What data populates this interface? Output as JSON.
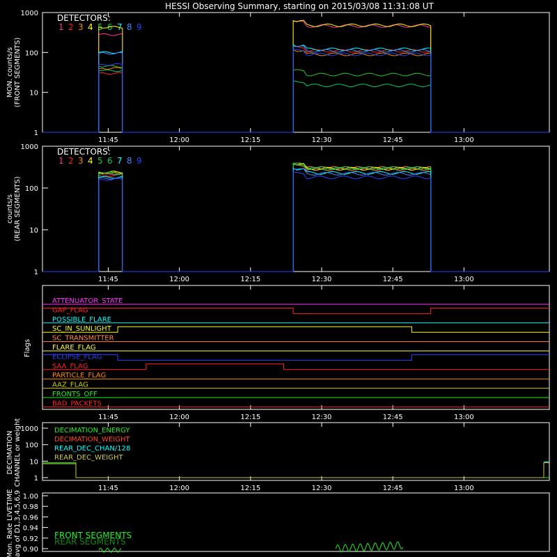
{
  "title": "HESSI Observing Summary, starting on 2015/03/08 11:31:08 UT",
  "time_ticks": [
    "11:45",
    "12:00",
    "12:15",
    "12:30",
    "12:45",
    "13:00"
  ],
  "det_colors": [
    "#ff3399",
    "#ff2222",
    "#ff8800",
    "#ffff00",
    "#22cc22",
    "#00cc66",
    "#00ffff",
    "#4488ff",
    "#2244ff"
  ],
  "chart_data": [
    {
      "type": "line",
      "ylabel": [
        "MON. counts/s",
        "(FRONT SEGMENTS)"
      ],
      "yscale": "log",
      "ylim": [
        1,
        1000
      ],
      "yticks": [
        "1",
        "10",
        "100",
        "1000"
      ],
      "legend_title": "DETECTORS:",
      "legend_numbers": [
        "1",
        "2",
        "3",
        "4",
        "5",
        "6",
        "7",
        "8",
        "9"
      ],
      "intervals": [
        {
          "start": "11:43",
          "end": "11:48"
        },
        {
          "start": "12:24",
          "end": "12:53"
        }
      ],
      "series": [
        {
          "values_first": 280,
          "values_second": 460
        },
        {
          "values_first": 30,
          "values_second": 110
        },
        {
          "values_first": 40,
          "values_second": 90
        },
        {
          "values_first": 430,
          "values_second": 480
        },
        {
          "values_first": 45,
          "values_second": 28
        },
        {
          "values_first": 35,
          "values_second": 15
        },
        {
          "values_first": 100,
          "values_second": 120
        },
        {
          "values_first": 95,
          "values_second": 110
        },
        {
          "values_first": 50,
          "values_second": 90
        }
      ]
    },
    {
      "type": "line",
      "ylabel": [
        "counts/s",
        "(REAR SEGMENTS)"
      ],
      "yscale": "log",
      "ylim": [
        1,
        1000
      ],
      "yticks": [
        "1",
        "10",
        "100",
        "1000"
      ],
      "legend_title": "DETECTORS:",
      "legend_numbers": [
        "1",
        "2",
        "3",
        "4",
        "5",
        "6",
        "7",
        "8",
        "9"
      ],
      "intervals": [
        {
          "start": "11:43",
          "end": "11:48"
        },
        {
          "start": "12:24",
          "end": "12:53"
        }
      ],
      "series": [
        {
          "values_first": 220,
          "values_second": 300
        },
        {
          "values_first": 200,
          "values_second": 280
        },
        {
          "values_first": 230,
          "values_second": 300
        },
        {
          "values_first": 240,
          "values_second": 290
        },
        {
          "values_first": 230,
          "values_second": 300
        },
        {
          "values_first": 220,
          "values_second": 290
        },
        {
          "values_first": 180,
          "values_second": 230
        },
        {
          "values_first": 170,
          "values_second": 220
        },
        {
          "values_first": 160,
          "values_second": 180
        }
      ]
    },
    {
      "type": "step",
      "ylabel": "Flags",
      "flags": [
        {
          "name": "ATTENUATOR_STATE",
          "color": "#ff33ff",
          "transitions": []
        },
        {
          "name": "GAP_FLAG",
          "color": "#ff2222",
          "transitions": [
            "12:24",
            "12:53"
          ]
        },
        {
          "name": "POSSIBLE_FLARE",
          "color": "#00ffff",
          "transitions": []
        },
        {
          "name": "SC_IN_SUNLIGHT",
          "color": "#ffff00",
          "transitions": [
            "11:47",
            "12:49"
          ]
        },
        {
          "name": "SC_TRANSMITTER",
          "color": "#ff8844",
          "transitions": []
        },
        {
          "name": "FLARE_FLAG",
          "color": "#ffff44",
          "transitions": []
        },
        {
          "name": "ECLIPSE_FLAG",
          "color": "#2244ff",
          "transitions": [
            "11:47",
            "12:49"
          ]
        },
        {
          "name": "SAA_FLAG",
          "color": "#ff2222",
          "transitions": [
            "11:53",
            "12:22"
          ]
        },
        {
          "name": "PARTICLE_FLAG",
          "color": "#ff8800",
          "transitions": []
        },
        {
          "name": "AAZ_FLAG",
          "color": "#cccc00",
          "transitions": []
        },
        {
          "name": "FRONTS_OFF",
          "color": "#22ee22",
          "transitions": []
        },
        {
          "name": "BAD_PACKETS",
          "color": "#ff2222",
          "transitions": []
        }
      ]
    },
    {
      "type": "line",
      "ylabel": [
        "DECIMATION",
        "CHANNEL or weight"
      ],
      "yscale": "log",
      "yticks": [
        "1",
        "10",
        "100",
        "1000"
      ],
      "legend": [
        {
          "name": "DECIMATION_ENERGY",
          "color": "#22ee22"
        },
        {
          "name": "DECIMATION_WEIGHT",
          "color": "#ff4422"
        },
        {
          "name": "REAR_DEC_CHAN/128",
          "color": "#00ffff"
        },
        {
          "name": "REAR_DEC_WEIGHT",
          "color": "#cccc44"
        }
      ]
    },
    {
      "type": "line",
      "ylabel": [
        "Mon. Rate LIVETIME",
        "avg of D1,3,4,5,6,9"
      ],
      "ylim": [
        0.9,
        1.0
      ],
      "yticks": [
        "0.90",
        "0.92",
        "0.94",
        "0.96",
        "0.98",
        "1.00"
      ],
      "legend": [
        {
          "name": "FRONT SEGMENTS",
          "color": "#22ee22"
        },
        {
          "name": "REAR SEGMENTS",
          "color": "#118811"
        }
      ]
    }
  ]
}
